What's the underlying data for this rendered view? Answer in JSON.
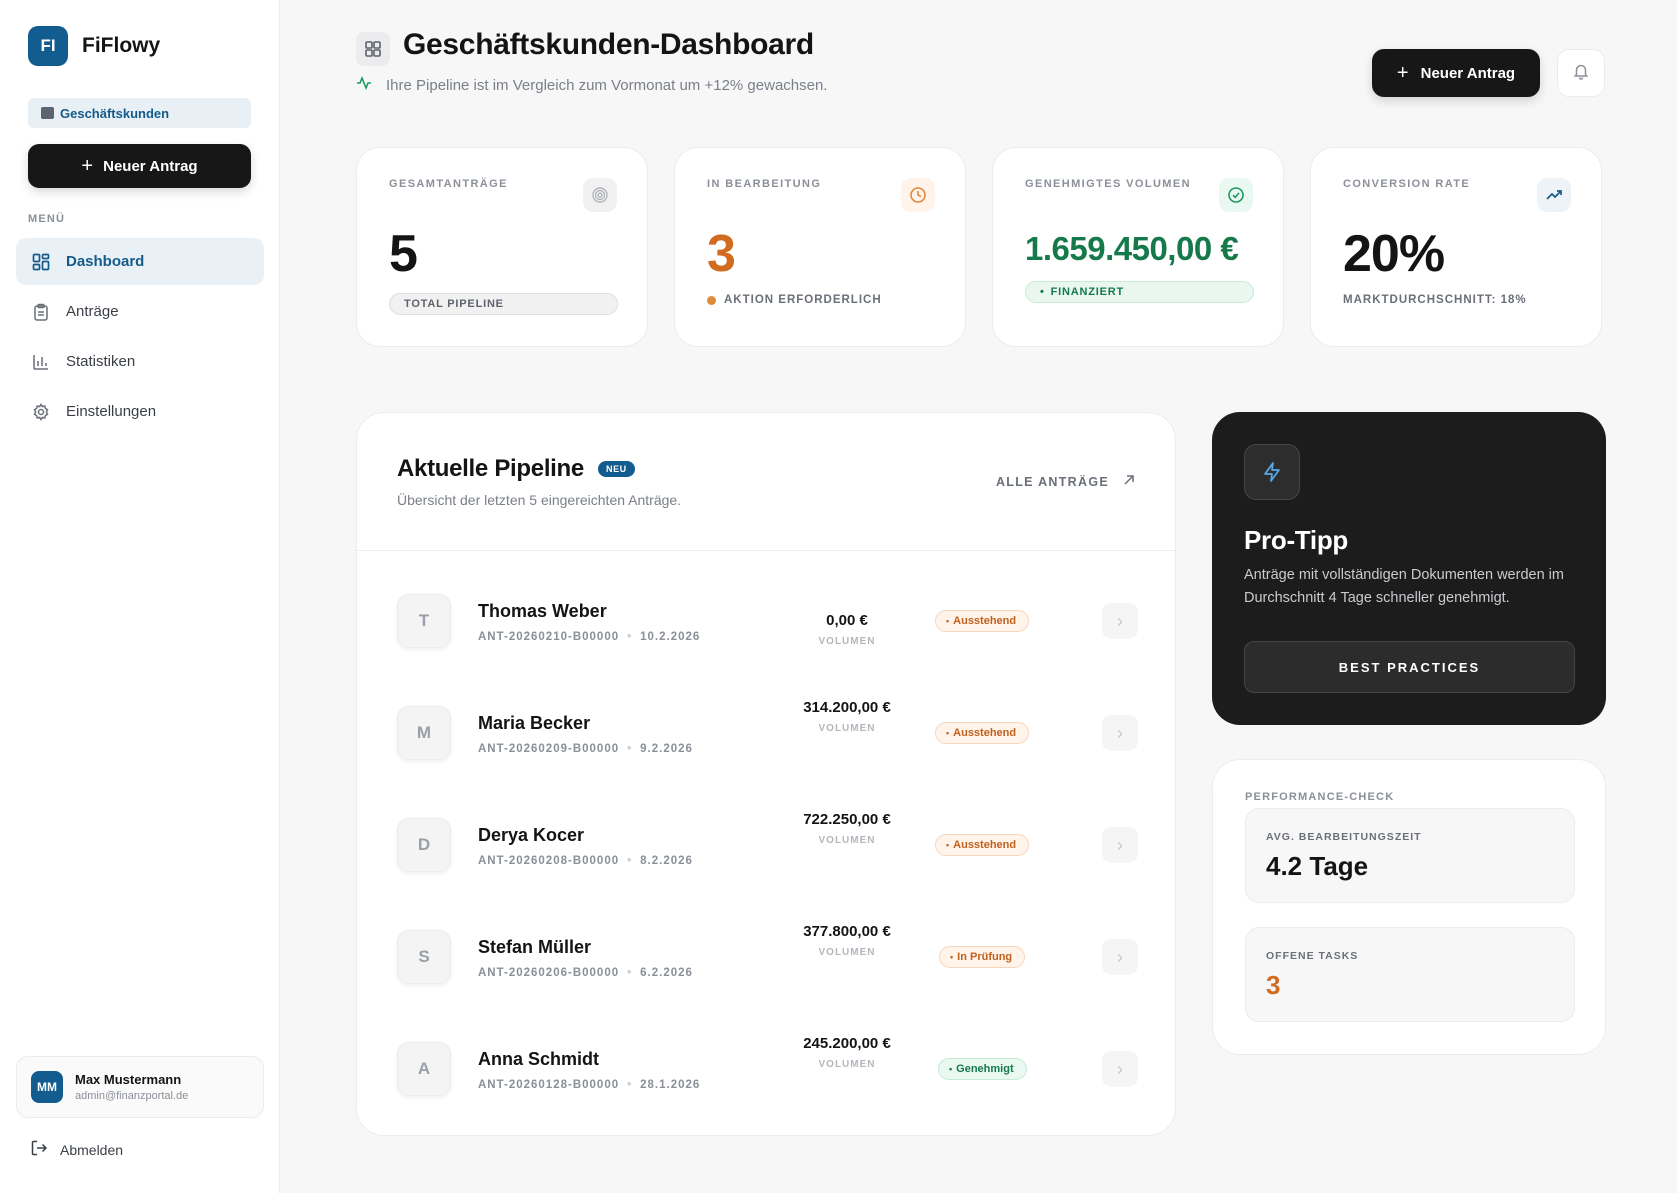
{
  "sidebar": {
    "logo_initials": "FI",
    "app_name": "FiFlowy",
    "segment": "Geschäftskunden",
    "new_request": "Neuer Antrag",
    "menu_label": "MENÜ",
    "items": [
      {
        "label": "Dashboard",
        "icon": "grid-icon",
        "active": true
      },
      {
        "label": "Anträge",
        "icon": "clipboard-icon",
        "active": false
      },
      {
        "label": "Statistiken",
        "icon": "bar-chart-icon",
        "active": false
      },
      {
        "label": "Einstellungen",
        "icon": "gear-icon",
        "active": false
      }
    ],
    "user": {
      "initials": "MM",
      "name": "Max Mustermann",
      "email": "admin@finanzportal.de"
    },
    "logout": "Abmelden"
  },
  "header": {
    "title": "Geschäftskunden-Dashboard",
    "subtitle": "Ihre Pipeline ist im Vergleich zum Vormonat um +12% gewachsen.",
    "new_request": "Neuer Antrag"
  },
  "kpis": [
    {
      "label": "GESAMTANTRÄGE",
      "value": "5",
      "pill": "TOTAL PIPELINE",
      "icon": "target-icon"
    },
    {
      "label": "IN BEARBEITUNG",
      "value": "3",
      "note": "AKTION ERFORDERLICH",
      "icon": "clock-icon"
    },
    {
      "label": "GENEHMIGTES VOLUMEN",
      "value": "1.659.450,00 €",
      "pill": "FINANZIERT",
      "icon": "check-circle-icon"
    },
    {
      "label": "CONVERSION RATE",
      "value": "20%",
      "note": "MARKTDURCHSCHNITT: 18%",
      "icon": "trending-up-icon"
    }
  ],
  "pipeline": {
    "title": "Aktuelle Pipeline",
    "badge": "NEU",
    "subtitle": "Übersicht der letzten 5 eingereichten Anträge.",
    "all_link": "ALLE ANTRÄGE",
    "volume_label": "VOLUMEN",
    "rows": [
      {
        "initial": "T",
        "name": "Thomas Weber",
        "id": "ANT-20260210-B00000",
        "date": "10.2.2026",
        "amount": "0,00 €",
        "status": "Ausstehend",
        "status_type": "pending"
      },
      {
        "initial": "M",
        "name": "Maria Becker",
        "id": "ANT-20260209-B00000",
        "date": "9.2.2026",
        "amount": "314.200,00 €",
        "status": "Ausstehend",
        "status_type": "pending"
      },
      {
        "initial": "D",
        "name": "Derya Kocer",
        "id": "ANT-20260208-B00000",
        "date": "8.2.2026",
        "amount": "722.250,00 €",
        "status": "Ausstehend",
        "status_type": "pending"
      },
      {
        "initial": "S",
        "name": "Stefan Müller",
        "id": "ANT-20260206-B00000",
        "date": "6.2.2026",
        "amount": "377.800,00 €",
        "status": "In Prüfung",
        "status_type": "pending"
      },
      {
        "initial": "A",
        "name": "Anna Schmidt",
        "id": "ANT-20260128-B00000",
        "date": "28.1.2026",
        "amount": "245.200,00 €",
        "status": "Genehmigt",
        "status_type": "approved"
      }
    ]
  },
  "tip": {
    "title": "Pro-Tipp",
    "text": "Anträge mit vollständigen Dokumenten werden im Durchschnitt 4 Tage schneller genehmigt.",
    "button": "BEST PRACTICES",
    "icon": "lightning-icon"
  },
  "performance": {
    "label": "PERFORMANCE-CHECK",
    "avg_label": "AVG. BEARBEITUNGSZEIT",
    "avg_value": "4.2 Tage",
    "tasks_label": "OFFENE TASKS",
    "tasks_value": "3"
  },
  "colors": {
    "brand": "#135c8f",
    "dark": "#171717",
    "orange": "#d06b1f",
    "green": "#16794a"
  }
}
